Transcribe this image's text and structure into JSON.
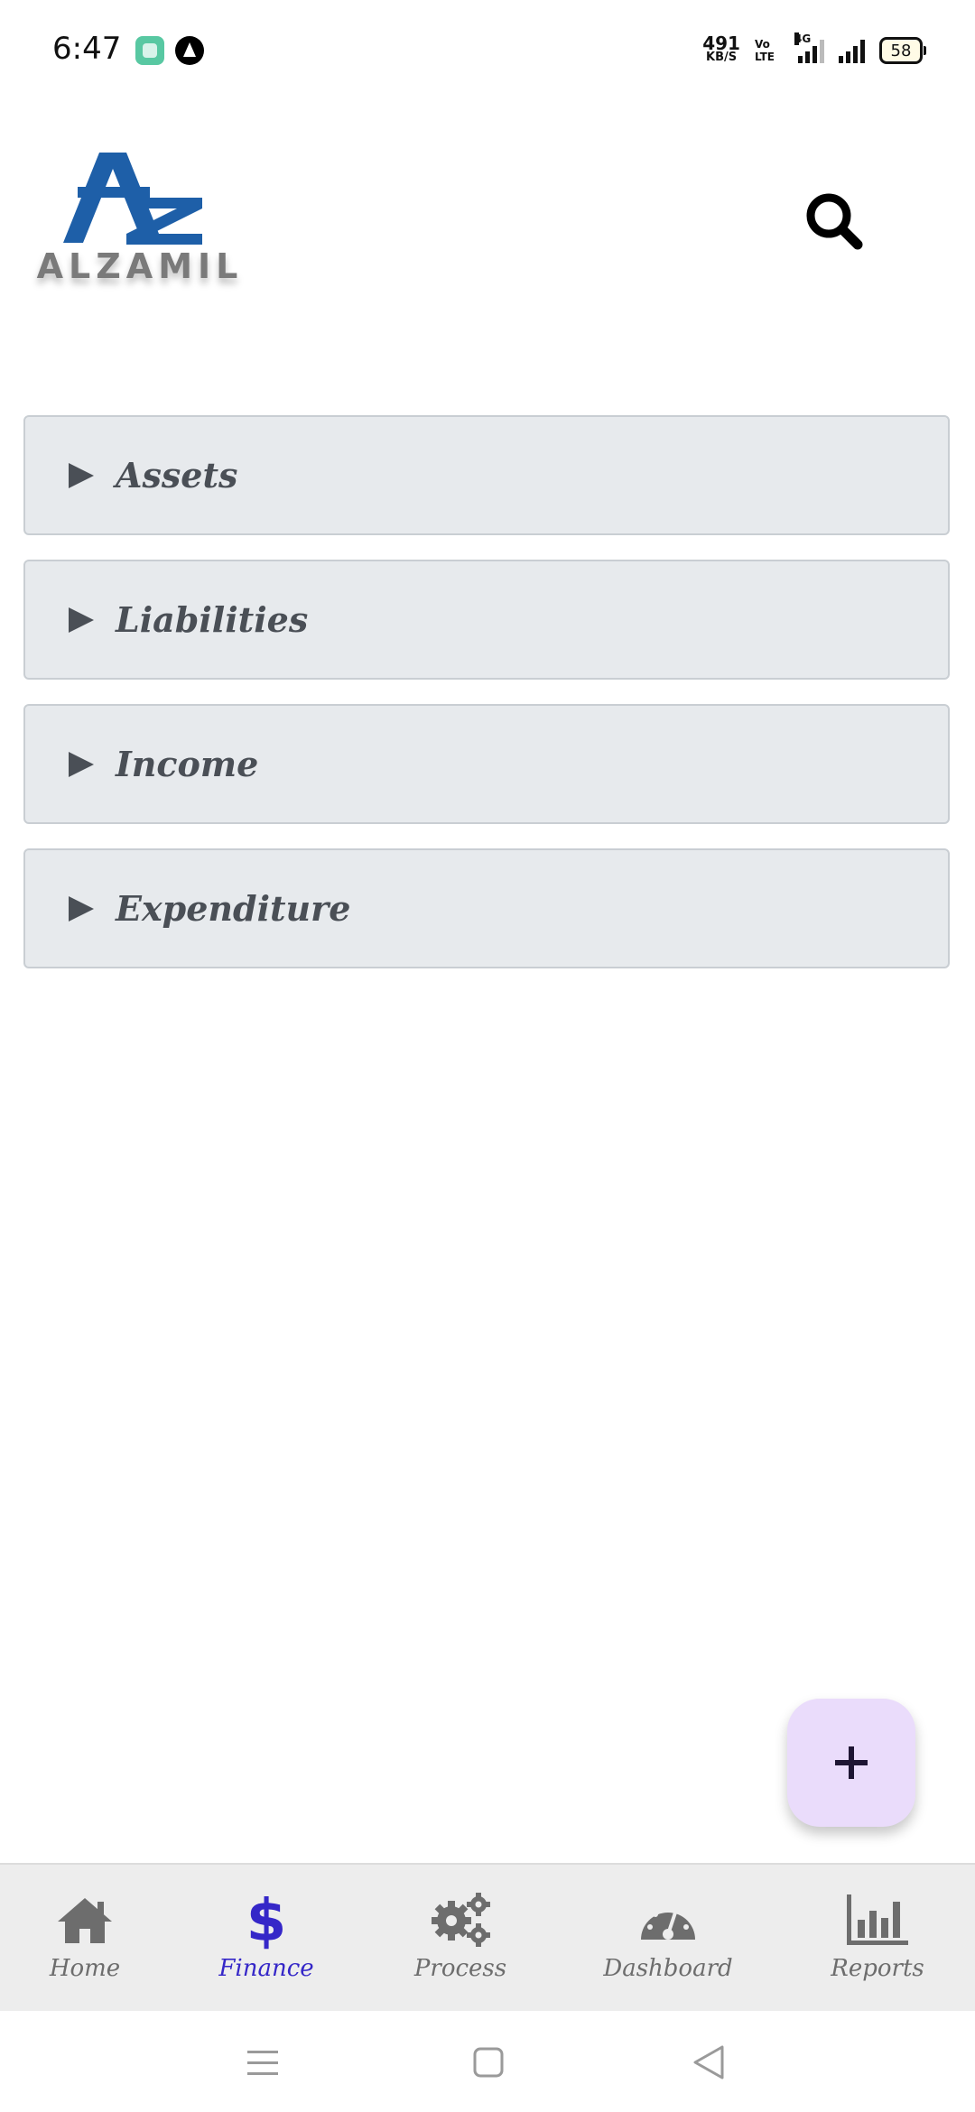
{
  "status_bar": {
    "time": "6:47",
    "net_speed_value": "491",
    "net_speed_unit": "KB/S",
    "volte_top": "Vo",
    "volte_bottom": "LTE",
    "network_type": "4G",
    "battery": "58"
  },
  "header": {
    "logo_text": "ALZAMIL",
    "logo_mark": "AZ",
    "brand_color": "#1e5fa8",
    "search_icon": "search-icon"
  },
  "accordion": {
    "items": [
      {
        "label": "Assets"
      },
      {
        "label": "Liabilities"
      },
      {
        "label": "Income"
      },
      {
        "label": "Expenditure"
      }
    ]
  },
  "fab": {
    "icon": "plus-icon",
    "color": "#eadcfb"
  },
  "bottom_nav": {
    "items": [
      {
        "label": "Home",
        "icon": "home-icon",
        "active": false
      },
      {
        "label": "Finance",
        "icon": "dollar-icon",
        "active": true
      },
      {
        "label": "Process",
        "icon": "gears-icon",
        "active": false
      },
      {
        "label": "Dashboard",
        "icon": "gauge-icon",
        "active": false
      },
      {
        "label": "Reports",
        "icon": "bar-chart-icon",
        "active": false
      }
    ],
    "active_color": "#3527c8",
    "inactive_color": "#6d6d6d"
  },
  "system_nav": {
    "buttons": [
      "menu-icon",
      "home-square-icon",
      "back-triangle-icon"
    ]
  }
}
